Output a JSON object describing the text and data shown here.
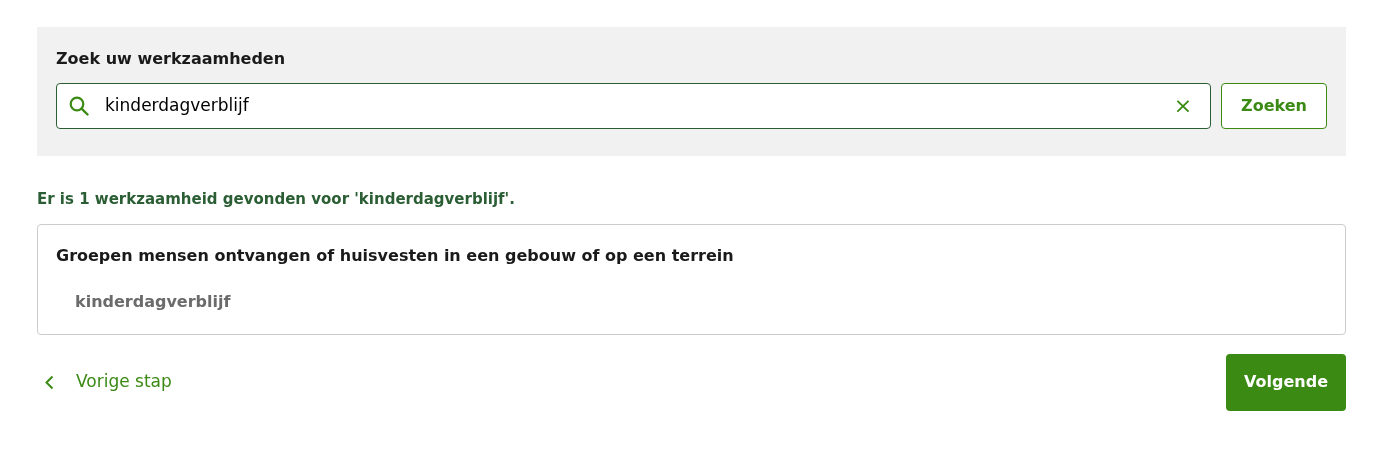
{
  "search": {
    "label": "Zoek uw werkzaamheden",
    "value": "kinderdagverblijf",
    "clear": "×",
    "button": "Zoeken"
  },
  "result_message": "Er is 1 werkzaamheid gevonden voor 'kinderdagverblijf'.",
  "results": [
    {
      "title": "Groepen mensen ontvangen of huisvesten in een gebouw of op een terrein",
      "items": [
        "kinderdagverblijf"
      ]
    }
  ],
  "navigation": {
    "back": "Vorige stap",
    "next": "Volgende"
  }
}
